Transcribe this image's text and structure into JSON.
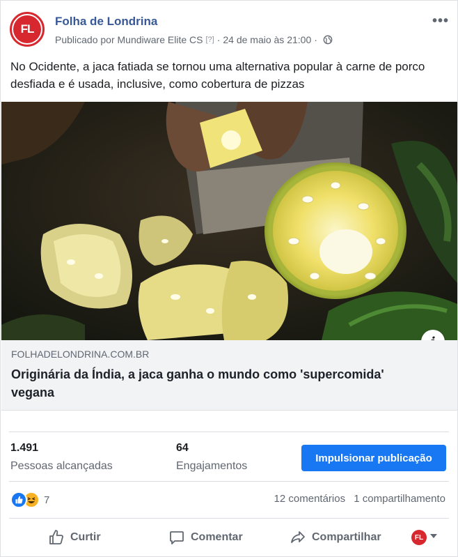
{
  "header": {
    "page_name": "Folha de Londrina",
    "avatar_initials": "FL",
    "published_prefix": "Publicado por",
    "creator": "Mundiware Elite CS",
    "help_mark": "[?]",
    "separator": "·",
    "date": "24 de maio às 21:00",
    "privacy_icon": "globe-icon",
    "more_icon": "•••"
  },
  "post": {
    "text": "No Ocidente, a jaca fatiada se tornou uma alternativa popular à carne de porco desfiada e é usada, inclusive, como cobertura de pizzas"
  },
  "link": {
    "domain": "FOLHADELONDRINA.COM.BR",
    "title": "Originária da Índia, a jaca ganha o mundo como 'supercomida' vegana",
    "info_icon": "i"
  },
  "insights": {
    "reach_value": "1.491",
    "reach_label": "Pessoas alcançadas",
    "engagement_value": "64",
    "engagement_label": "Engajamentos",
    "boost_label": "Impulsionar publicação"
  },
  "reactions": {
    "count": "7",
    "comments": "12 comentários",
    "shares": "1 compartilhamento"
  },
  "actions": {
    "like": "Curtir",
    "comment": "Comentar",
    "share": "Compartilhar",
    "avatar_initials": "FL"
  },
  "colors": {
    "brand_red": "#d7282f",
    "link_blue": "#385898",
    "boost_blue": "#1877f2"
  }
}
